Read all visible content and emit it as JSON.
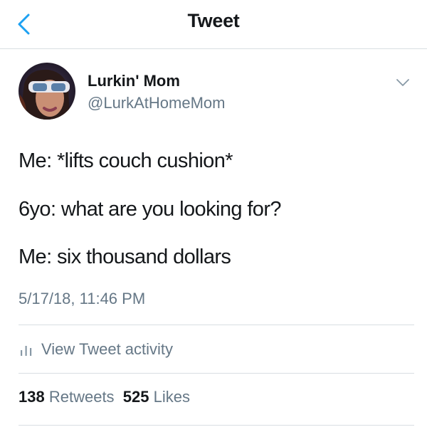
{
  "header": {
    "title": "Tweet",
    "back_icon": "chevron-left-icon",
    "accent_color": "#1da1f2"
  },
  "tweet": {
    "author": {
      "display_name": "Lurkin' Mom",
      "handle": "@LurkAtHomeMom"
    },
    "lines": [
      "Me: *lifts couch cushion*",
      "6yo: what are you looking for?",
      "Me: six thousand dollars"
    ],
    "timestamp": "5/17/18, 11:46 PM",
    "activity_label": "View Tweet activity",
    "stats": {
      "retweets_count": "138",
      "retweets_label": "Retweets",
      "likes_count": "525",
      "likes_label": "Likes"
    }
  },
  "colors": {
    "text_primary": "#14171a",
    "text_secondary": "#657786",
    "divider": "#d9dee2"
  }
}
